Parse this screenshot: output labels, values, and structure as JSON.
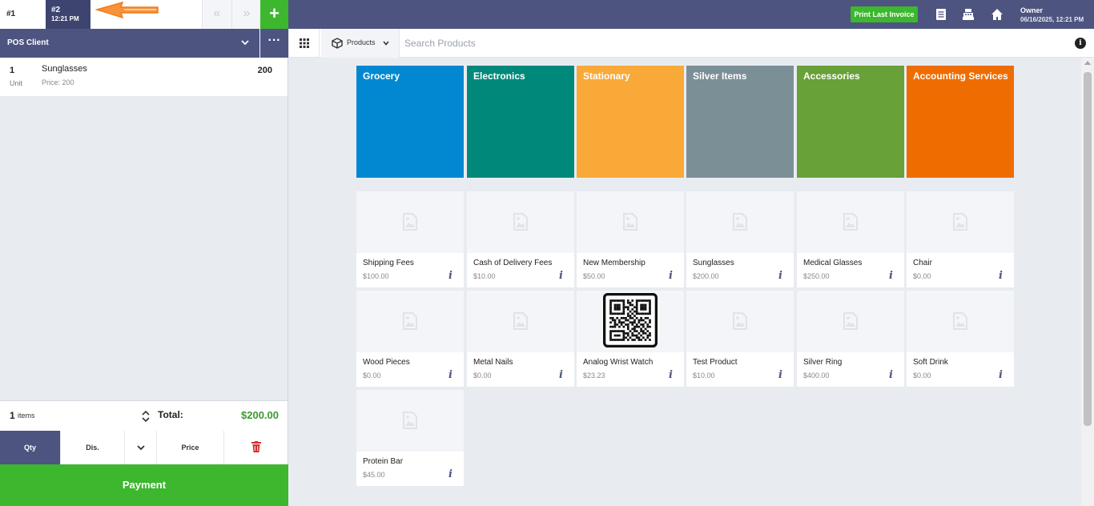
{
  "tabs": [
    {
      "label": "#1"
    },
    {
      "label": "#2",
      "time": "12:21 PM"
    }
  ],
  "header": {
    "prev_label": "«",
    "next_label": "»",
    "add_label": "+",
    "print_label": "Print Last Invoice",
    "user_name": "Owner",
    "datetime": "06/16/2025, 12:21 PM",
    "icons": [
      "orders-list-icon",
      "cash-register-icon",
      "home-icon"
    ]
  },
  "client": {
    "label": "POS Client",
    "more_label": "···"
  },
  "cart": {
    "items": [
      {
        "qty": "1",
        "unit": "Unit",
        "name": "Sunglasses",
        "price": "Price: 200",
        "amount": "200"
      }
    ],
    "count": "1",
    "count_label": "items",
    "total_label": "Total:",
    "total": "$200.00"
  },
  "actions": {
    "qty": "Qty",
    "discount": "Dis.",
    "price": "Price"
  },
  "payment_label": "Payment",
  "search": {
    "selector_label": "Products",
    "placeholder": "Search Products",
    "info_label": "i"
  },
  "categories": [
    {
      "name": "Grocery",
      "color": "#0288d1"
    },
    {
      "name": "Electronics",
      "color": "#00897b"
    },
    {
      "name": "Stationary",
      "color": "#f9a937"
    },
    {
      "name": "Silver Items",
      "color": "#7b8f97"
    },
    {
      "name": "Accessories",
      "color": "#68a138"
    },
    {
      "name": "Accounting Services",
      "color": "#ef6c00"
    }
  ],
  "products": [
    {
      "name": "Shipping Fees",
      "price": "$100.00"
    },
    {
      "name": "Cash of Delivery Fees",
      "price": "$10.00"
    },
    {
      "name": "New Membership",
      "price": "$50.00"
    },
    {
      "name": "Sunglasses",
      "price": "$200.00"
    },
    {
      "name": "Medical Glasses",
      "price": "$250.00"
    },
    {
      "name": "Chair",
      "price": "$0.00"
    },
    {
      "name": "Wood Pieces",
      "price": "$0.00"
    },
    {
      "name": "Metal Nails",
      "price": "$0.00"
    },
    {
      "name": "Analog Wrist Watch",
      "price": "$23.23"
    },
    {
      "name": "Test Product",
      "price": "$10.00"
    },
    {
      "name": "Silver Ring",
      "price": "$400.00"
    },
    {
      "name": "Soft Drink",
      "price": "$0.00"
    },
    {
      "name": "Protein Bar",
      "price": "$45.00"
    }
  ],
  "product_info_label": "i"
}
